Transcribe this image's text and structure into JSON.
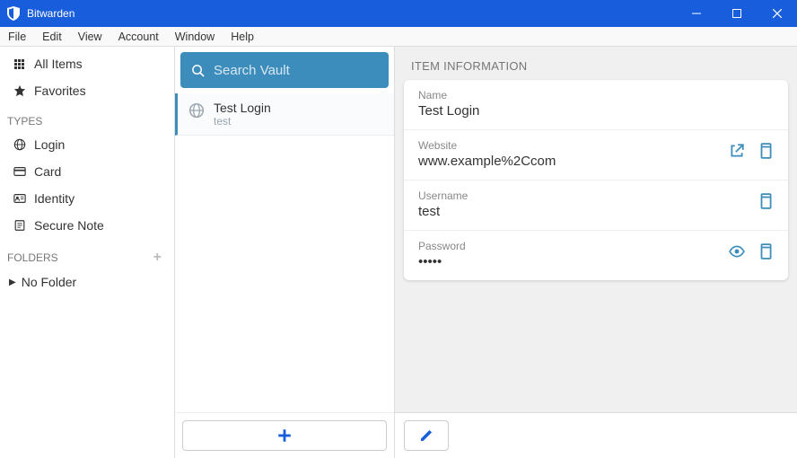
{
  "window": {
    "title": "Bitwarden"
  },
  "menu": {
    "file": "File",
    "edit": "Edit",
    "view": "View",
    "account": "Account",
    "window": "Window",
    "help": "Help"
  },
  "sidebar": {
    "all_items": "All Items",
    "favorites": "Favorites",
    "types_header": "TYPES",
    "login": "Login",
    "card": "Card",
    "identity": "Identity",
    "secure_note": "Secure Note",
    "folders_header": "FOLDERS",
    "no_folder": "No Folder"
  },
  "search": {
    "placeholder": "Search Vault"
  },
  "list": {
    "items": [
      {
        "title": "Test Login",
        "subtitle": "test"
      }
    ]
  },
  "detail": {
    "header": "ITEM INFORMATION",
    "name_label": "Name",
    "name_value": "Test Login",
    "website_label": "Website",
    "website_value": "www.example%2Ccom",
    "username_label": "Username",
    "username_value": "test",
    "password_label": "Password",
    "password_value": "•••••"
  }
}
